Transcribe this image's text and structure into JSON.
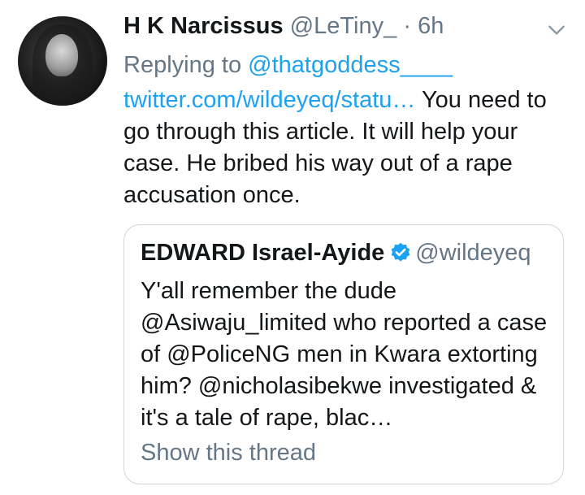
{
  "tweet": {
    "author_name": "H K Narcissus",
    "author_handle": "@LeTiny_",
    "separator": "·",
    "time": "6h",
    "replying_prefix": "Replying to",
    "replying_to": "@thatgoddess____",
    "link_text": "twitter.com/wildeyeq/statu…",
    "body_text": " You need to go through this article. It will help your case. He bribed his way out of a rape accusation once.",
    "icons": {
      "menu": "chevron-down-icon",
      "avatar": "profile-photo"
    }
  },
  "quoted_tweet": {
    "author_name": "EDWARD Israel-Ayide",
    "verified": true,
    "author_handle": "@wildeyeq",
    "text": "Y'all remember the dude @Asiwaju_limited who reported a case of @PoliceNG men in Kwara extorting him? @nicholasibekwe investigated & it's a tale of rape, blac…",
    "show_thread": "Show this thread",
    "icons": {
      "verified": "verified-badge-icon"
    }
  },
  "colors": {
    "text_primary": "#14171a",
    "text_secondary": "#657786",
    "accent": "#1da1f2",
    "border": "#ccd6dd"
  }
}
